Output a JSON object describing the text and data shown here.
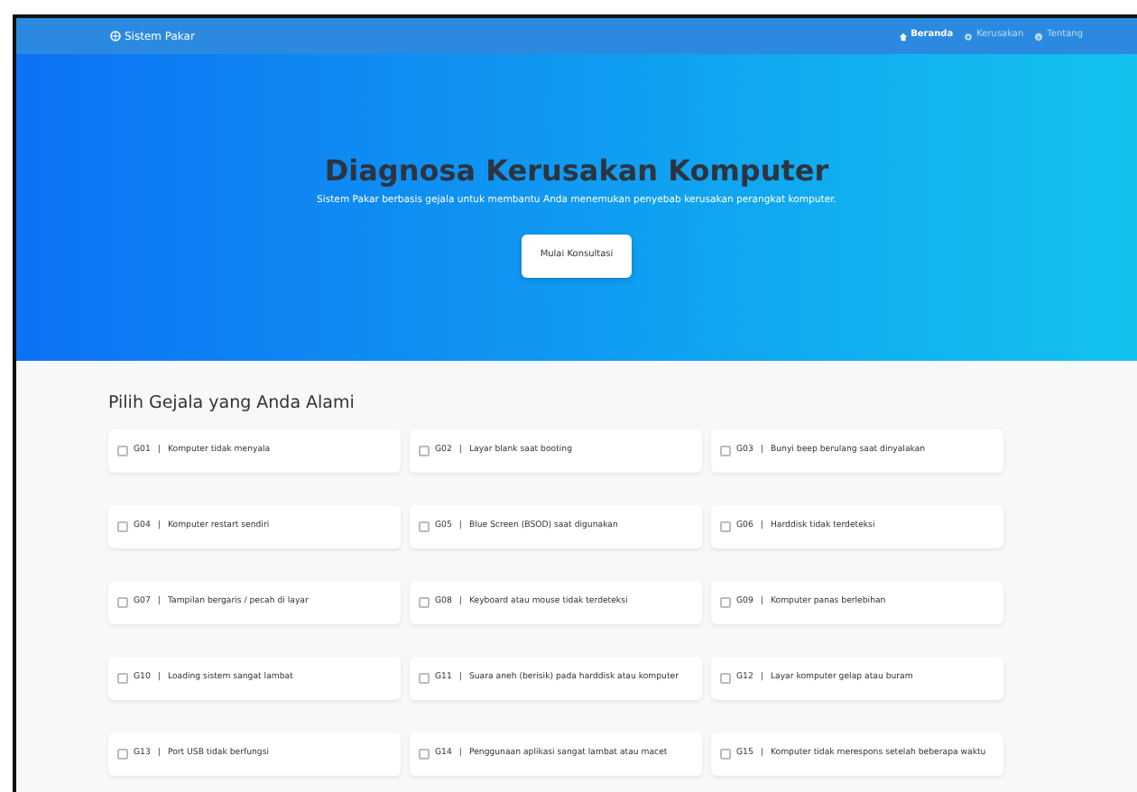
{
  "navbar": {
    "brand": "Sistem Pakar",
    "links": [
      {
        "label": "Beranda",
        "selected": true
      },
      {
        "label": "Kerusakan",
        "selected": false
      },
      {
        "label": "Tentang",
        "selected": false
      }
    ]
  },
  "hero": {
    "title": "Diagnosa Kerusakan Komputer",
    "subtitle": "Sistem Pakar berbasis gejala untuk membantu Anda menemukan penyebab kerusakan perangkat komputer.",
    "button": "Mulai Konsultasi"
  },
  "symptoms": {
    "heading": "Pilih Gejala yang Anda Alami",
    "items": [
      {
        "code": "G01",
        "separator": "|",
        "label": "Komputer tidak menyala",
        "checked": false
      },
      {
        "code": "G02",
        "separator": "|",
        "label": "Layar blank saat booting",
        "checked": false
      },
      {
        "code": "G03",
        "separator": "|",
        "label": "Bunyi beep berulang saat dinyalakan",
        "checked": false
      },
      {
        "code": "G04",
        "separator": "|",
        "label": "Komputer restart sendiri",
        "checked": false
      },
      {
        "code": "G05",
        "separator": "|",
        "label": "Blue Screen (BSOD) saat digunakan",
        "checked": false
      },
      {
        "code": "G06",
        "separator": "|",
        "label": "Harddisk tidak terdeteksi",
        "checked": false
      },
      {
        "code": "G07",
        "separator": "|",
        "label": "Tampilan bergaris / pecah di layar",
        "checked": false
      },
      {
        "code": "G08",
        "separator": "|",
        "label": "Keyboard atau mouse tidak terdeteksi",
        "checked": false
      },
      {
        "code": "G09",
        "separator": "|",
        "label": "Komputer panas berlebihan",
        "checked": false
      },
      {
        "code": "G10",
        "separator": "|",
        "label": "Loading sistem sangat lambat",
        "checked": false
      },
      {
        "code": "G11",
        "separator": "|",
        "label": "Suara aneh (berisik) pada harddisk atau komputer",
        "checked": false
      },
      {
        "code": "G12",
        "separator": "|",
        "label": "Layar komputer gelap atau buram",
        "checked": false
      },
      {
        "code": "G13",
        "separator": "|",
        "label": "Port USB tidak berfungsi",
        "checked": false
      },
      {
        "code": "G14",
        "separator": "|",
        "label": "Penggunaan aplikasi sangat lambat atau macet",
        "checked": false
      },
      {
        "code": "G15",
        "separator": "|",
        "label": "Komputer tidak merespons setelah beberapa waktu",
        "checked": false
      }
    ]
  }
}
